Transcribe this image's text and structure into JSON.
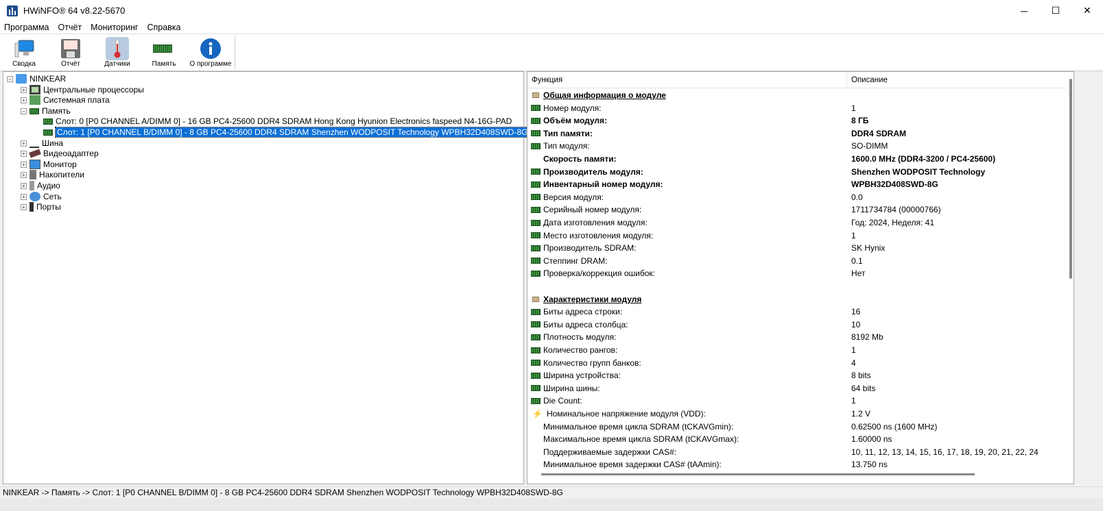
{
  "window": {
    "title": "HWiNFO® 64 v8.22-5670",
    "minimize": "─",
    "maximize": "☐",
    "close": "✕"
  },
  "menu": [
    "Программа",
    "Отчёт",
    "Мониторинг",
    "Справка"
  ],
  "toolbar": [
    {
      "label": "Сводка",
      "icon": "monitor-icon"
    },
    {
      "label": "Отчёт",
      "icon": "floppy-icon"
    },
    {
      "label": "Датчики",
      "icon": "thermometer-icon"
    },
    {
      "label": "Память",
      "icon": "memory-icon"
    },
    {
      "label": "О программе",
      "icon": "info-icon"
    }
  ],
  "tree": {
    "root": "NINKEAR",
    "items": [
      {
        "label": "Центральные процессоры"
      },
      {
        "label": "Системная плата"
      },
      {
        "label": "Память",
        "children": [
          "Слот: 0 [P0 CHANNEL A/DIMM 0] - 16 GB PC4-25600 DDR4 SDRAM Hong Kong Hyunion Electronics faspeed N4-16G-PAD",
          "Слот: 1 [P0 CHANNEL B/DIMM 0] - 8 GB PC4-25600 DDR4 SDRAM Shenzhen WODPOSIT Technology WPBH32D408SWD-8G"
        ]
      },
      {
        "label": "Шина"
      },
      {
        "label": "Видеоадаптер"
      },
      {
        "label": "Монитор"
      },
      {
        "label": "Накопители"
      },
      {
        "label": "Аудио"
      },
      {
        "label": "Сеть"
      },
      {
        "label": "Порты"
      }
    ]
  },
  "details": {
    "headers": {
      "feature": "Функция",
      "description": "Описание"
    },
    "sections": [
      {
        "title": "Общая информация о модуле",
        "rows": [
          {
            "k": "Номер модуля:",
            "v": "1",
            "icon": "mem"
          },
          {
            "k": "Объём модуля:",
            "v": "8 ГБ",
            "icon": "mem",
            "bold": true
          },
          {
            "k": "Тип памяти:",
            "v": "DDR4 SDRAM",
            "icon": "mem",
            "bold": true
          },
          {
            "k": "Тип модуля:",
            "v": "SO-DIMM",
            "icon": "mem"
          },
          {
            "k": "Скорость памяти:",
            "v": "1600.0 MHz (DDR4-3200 / PC4-25600)",
            "icon": "none",
            "bold": true
          },
          {
            "k": "Производитель модуля:",
            "v": "Shenzhen WODPOSIT Technology",
            "icon": "mem",
            "bold": true
          },
          {
            "k": "Инвентарный номер модуля:",
            "v": "WPBH32D408SWD-8G",
            "icon": "mem",
            "bold": true
          },
          {
            "k": "Версия модуля:",
            "v": "0.0",
            "icon": "mem"
          },
          {
            "k": "Серийный номер модуля:",
            "v": "1711734784 (00000766)",
            "icon": "mem"
          },
          {
            "k": "Дата изготовления модуля:",
            "v": "Год: 2024, Неделя: 41",
            "icon": "mem"
          },
          {
            "k": "Место изготовления модуля:",
            "v": "1",
            "icon": "mem"
          },
          {
            "k": "Производитель SDRAM:",
            "v": "SK Hynix",
            "icon": "mem"
          },
          {
            "k": "Степпинг DRAM:",
            "v": "0.1",
            "icon": "mem"
          },
          {
            "k": "Проверка/коррекция ошибок:",
            "v": "Нет",
            "icon": "mem"
          }
        ]
      },
      {
        "title": "Характеристики модуля",
        "rows": [
          {
            "k": "Биты адреса строки:",
            "v": "16",
            "icon": "mem"
          },
          {
            "k": "Биты адреса столбца:",
            "v": "10",
            "icon": "mem"
          },
          {
            "k": "Плотность модуля:",
            "v": "8192 Mb",
            "icon": "mem"
          },
          {
            "k": "Количество рангов:",
            "v": "1",
            "icon": "mem"
          },
          {
            "k": "Количество групп банков:",
            "v": "4",
            "icon": "mem"
          },
          {
            "k": "Ширина устройства:",
            "v": "8 bits",
            "icon": "mem"
          },
          {
            "k": "Ширина шины:",
            "v": "64 bits",
            "icon": "mem"
          },
          {
            "k": "Die Count:",
            "v": "1",
            "icon": "mem"
          },
          {
            "k": "Номинальное напряжение модуля (VDD):",
            "v": "1.2 V",
            "icon": "bolt"
          },
          {
            "k": "Минимальное время цикла SDRAM (tCKAVGmin):",
            "v": "0.62500 ns (1600 MHz)",
            "icon": "none"
          },
          {
            "k": "Максимальное время цикла SDRAM (tCKAVGmax):",
            "v": "1.60000 ns",
            "icon": "none"
          },
          {
            "k": "Поддерживаемые задержки CAS#:",
            "v": "10, 11, 12, 13, 14, 15, 16, 17, 18, 19, 20, 21, 22, 24",
            "icon": "none"
          },
          {
            "k": "Минимальное время задержки CAS# (tAAmin):",
            "v": "13.750 ns",
            "icon": "none"
          }
        ]
      }
    ]
  },
  "status": "NINKEAR -> Память -> Слот: 1 [P0 CHANNEL B/DIMM 0] - 8 GB PC4-25600 DDR4 SDRAM Shenzhen WODPOSIT Technology WPBH32D408SWD-8G"
}
